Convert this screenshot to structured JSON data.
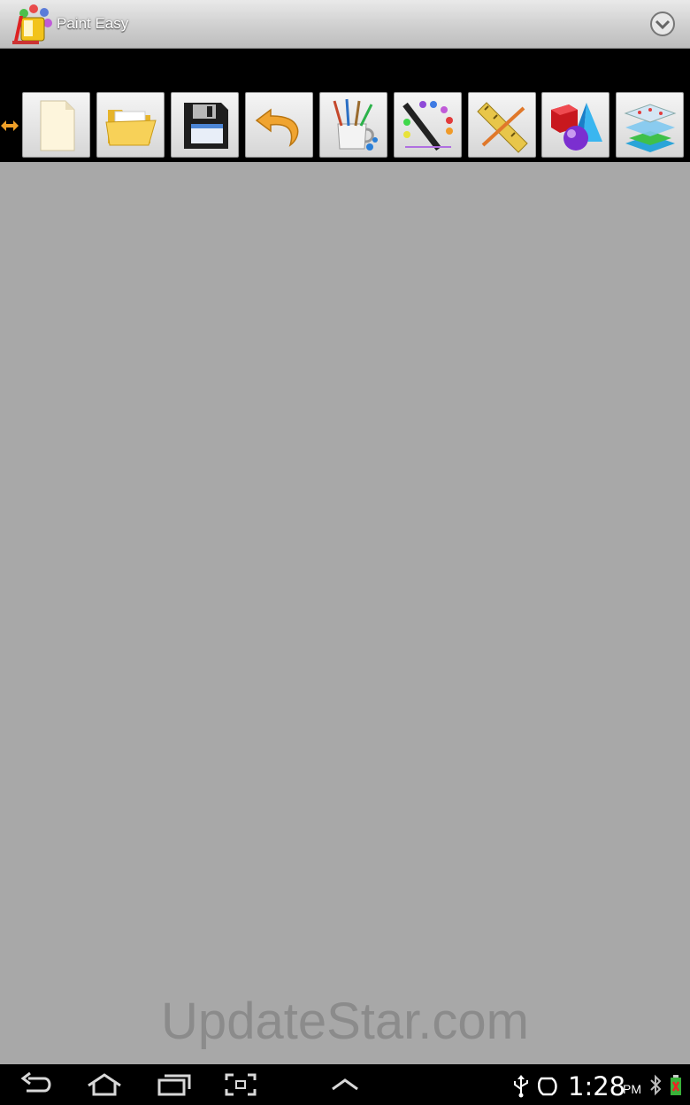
{
  "app": {
    "title": "Paint Easy"
  },
  "toolbar": {
    "tools": [
      {
        "name": "new-file-icon"
      },
      {
        "name": "open-folder-icon"
      },
      {
        "name": "save-disk-icon"
      },
      {
        "name": "undo-icon"
      },
      {
        "name": "brushes-icon"
      },
      {
        "name": "color-palette-icon"
      },
      {
        "name": "ruler-icon"
      },
      {
        "name": "shapes-icon"
      },
      {
        "name": "layers-icon"
      }
    ]
  },
  "watermark": "UpdateStar.com",
  "status": {
    "time": "1:28",
    "ampm": "PM"
  }
}
